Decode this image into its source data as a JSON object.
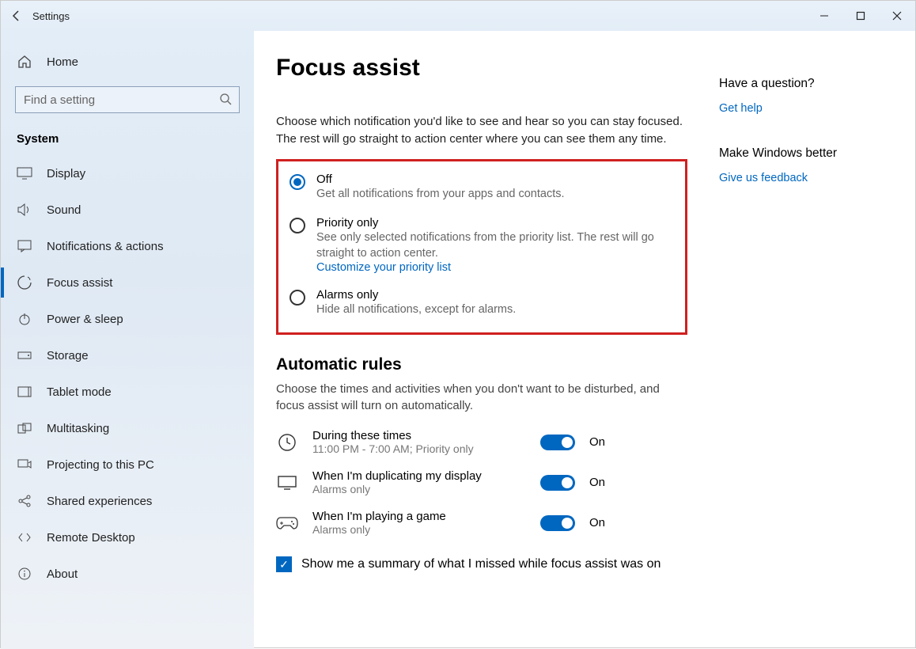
{
  "window": {
    "title": "Settings"
  },
  "sidebar": {
    "home": "Home",
    "search_placeholder": "Find a setting",
    "category": "System",
    "items": [
      {
        "label": "Display"
      },
      {
        "label": "Sound"
      },
      {
        "label": "Notifications & actions"
      },
      {
        "label": "Focus assist",
        "active": true
      },
      {
        "label": "Power & sleep"
      },
      {
        "label": "Storage"
      },
      {
        "label": "Tablet mode"
      },
      {
        "label": "Multitasking"
      },
      {
        "label": "Projecting to this PC"
      },
      {
        "label": "Shared experiences"
      },
      {
        "label": "Remote Desktop"
      },
      {
        "label": "About"
      }
    ]
  },
  "page": {
    "title": "Focus assist",
    "intro": "Choose which notification you'd like to see and hear so you can stay focused. The rest will go straight to action center where you can see them any time.",
    "options": {
      "off": {
        "label": "Off",
        "sub": "Get all notifications from your apps and contacts."
      },
      "prio": {
        "label": "Priority only",
        "sub": "See only selected notifications from the priority list. The rest will go straight to action center.",
        "link": "Customize your priority list"
      },
      "alarm": {
        "label": "Alarms only",
        "sub": "Hide all notifications, except for alarms."
      }
    },
    "auto": {
      "heading": "Automatic rules",
      "sub": "Choose the times and activities when you don't want to be disturbed, and focus assist will turn on automatically.",
      "rules": [
        {
          "title": "During these times",
          "sub": "11:00 PM - 7:00 AM; Priority only",
          "state": "On"
        },
        {
          "title": "When I'm duplicating my display",
          "sub": "Alarms only",
          "state": "On"
        },
        {
          "title": "When I'm playing a game",
          "sub": "Alarms only",
          "state": "On"
        }
      ]
    },
    "summary_check": "Show me a summary of what I missed while focus assist was on"
  },
  "aside": {
    "q": "Have a question?",
    "help": "Get help",
    "mw": "Make Windows better",
    "fb": "Give us feedback"
  }
}
